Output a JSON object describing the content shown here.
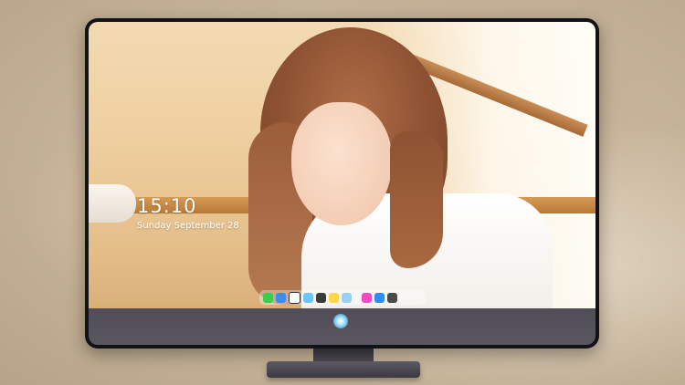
{
  "lockscreen": {
    "time": "15:10",
    "date": "Sunday September 28",
    "fine_print_line1": "",
    "fine_print_line2": ""
  },
  "dock": {
    "icons": [
      {
        "name": "messages-icon",
        "color": "#3ccf4e"
      },
      {
        "name": "finder-icon",
        "color": "#3b8ef0"
      },
      {
        "name": "clock-icon",
        "color": "#ffffff"
      },
      {
        "name": "photos-icon",
        "color": "#6bc6ff"
      },
      {
        "name": "video-icon",
        "color": "#3b3b3b"
      },
      {
        "name": "notes-icon",
        "color": "#ffd84a"
      },
      {
        "name": "preview-icon",
        "color": "#9ad0f5"
      },
      {
        "name": "music-icon",
        "color": "#f14cc5"
      },
      {
        "name": "app-store-icon",
        "color": "#2f8df5"
      },
      {
        "name": "trash-icon",
        "color": "#4a4a4a"
      }
    ]
  },
  "colors": {
    "monitor_frame": "#121316",
    "chin": "#565360",
    "clock_text": "#ffffff"
  }
}
